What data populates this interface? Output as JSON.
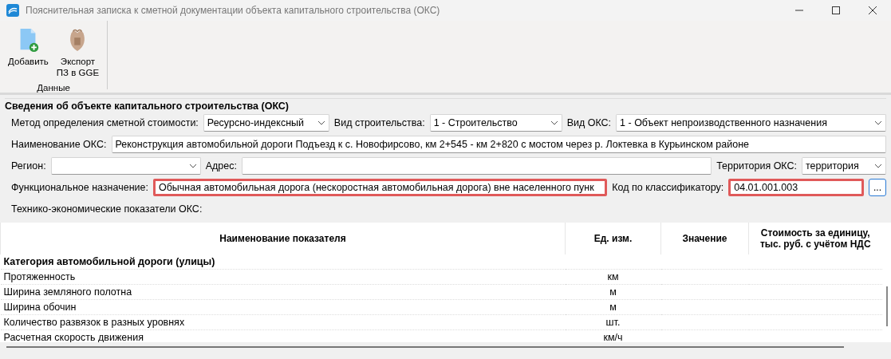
{
  "window": {
    "title": "Пояснительная записка к сметной документации объекта капитального строительства (ОКС)"
  },
  "ribbon": {
    "buttons": [
      {
        "label": "Добавить"
      },
      {
        "label": "Экспорт\nПЗ в GGE"
      }
    ],
    "group": "Данные"
  },
  "section": {
    "title": "Сведения об объекте капитального строительства (ОКС)"
  },
  "rows": [
    [
      {
        "kind": "label",
        "text": "Метод определения сметной стоимости:"
      },
      {
        "kind": "combo",
        "value": "Ресурсно-индексный"
      },
      {
        "kind": "label",
        "text": "Вид строительства:"
      },
      {
        "kind": "combo",
        "value": "1 - Строительство"
      },
      {
        "kind": "label",
        "text": "Вид ОКС:"
      },
      {
        "kind": "combo",
        "value": "1 - Объект непроизводственного назначения"
      }
    ],
    [
      {
        "kind": "label",
        "text": "Наименование ОКС:"
      },
      {
        "kind": "field",
        "value": "Реконструкция автомобильной дороги Подъезд к с. Новофирсово, км 2+545 - км 2+820 с мостом через р. Локтевка в Курьинском районе",
        "error": false
      }
    ],
    [
      {
        "kind": "label",
        "text": "Регион:"
      },
      {
        "kind": "combo"
      },
      {
        "kind": "label",
        "text": "Адрес:"
      },
      {
        "kind": "field",
        "error": false
      },
      {
        "kind": "label",
        "text": "Территория ОКС:"
      },
      {
        "kind": "combo",
        "value": "территория"
      }
    ],
    [
      {
        "kind": "label",
        "text": "Функциональное назначение:"
      },
      {
        "kind": "field",
        "value": "Обычная автомобильная дорога (нескоростная автомобильная дорога) вне населенного пунк",
        "error": true
      },
      {
        "kind": "label",
        "text": "Код по классификатору:"
      },
      {
        "kind": "field",
        "value": "04.01.001.003",
        "error": true
      },
      {
        "kind": "more",
        "text": "..."
      }
    ],
    [
      {
        "kind": "label",
        "text": "Технико-экономические показатели ОКС:"
      }
    ]
  ],
  "table": {
    "columns": [
      "Наименование показателя",
      "Ед. изм.",
      "Значение",
      "Стоимость за единицу,\nтыс. руб. с учётом НДС"
    ],
    "rows": [
      {
        "name": "Категория автомобильной дороги (улицы)",
        "group": true
      },
      {
        "name": "Протяженность",
        "unit": "км",
        "group": false
      },
      {
        "name": "Ширина земляного полотна",
        "unit": "м",
        "group": false
      },
      {
        "name": "Ширина обочин",
        "unit": "м",
        "group": false
      },
      {
        "name": "Количество развязок в разных уровнях",
        "unit": "шт.",
        "group": false
      },
      {
        "name": "Расчетная скорость движения",
        "unit": "км/ч",
        "group": false
      }
    ]
  }
}
